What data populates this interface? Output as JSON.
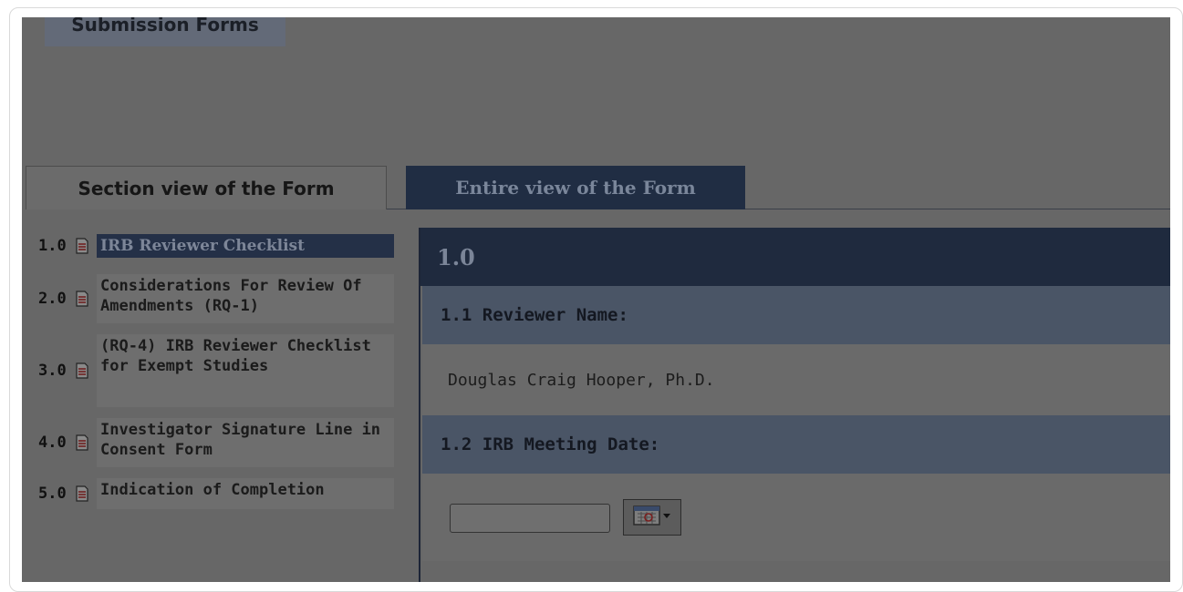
{
  "top_tab": {
    "label": "Submission Forms"
  },
  "tabs": {
    "section": "Section view of the Form",
    "entire": "Entire view of the Form"
  },
  "nav": [
    {
      "num": "1.0",
      "label": "IRB Reviewer Checklist",
      "active": true
    },
    {
      "num": "2.0",
      "label": "Considerations For Review Of Amendments (RQ-1)"
    },
    {
      "num": "3.0",
      "label": "(RQ-4) IRB Reviewer Checklist for Exempt Studies"
    },
    {
      "num": "4.0",
      "label": "Investigator Signature Line in Consent Form"
    },
    {
      "num": "5.0",
      "label": "Indication of Completion"
    }
  ],
  "panel": {
    "section_number": "1.0",
    "q1": {
      "label": "1.1   Reviewer Name:",
      "value": "Douglas Craig Hooper, Ph.D."
    },
    "q2": {
      "label": "1.2   IRB Meeting Date:",
      "date_value": ""
    }
  },
  "icons": {
    "nav_item": "document-icon",
    "date_picker": "calendar-icon"
  },
  "colors": {
    "active_tab": "#202d43",
    "question_header": "#4a5566",
    "overlay_gray": "#676767"
  }
}
